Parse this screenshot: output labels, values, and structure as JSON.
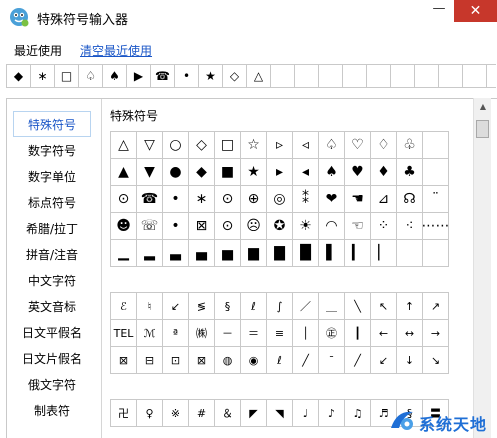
{
  "window": {
    "title": "特殊符号输入器",
    "minimize_label": "—",
    "close_label": "✕"
  },
  "recent": {
    "label": "最近使用",
    "clear_label": "清空最近使用",
    "symbols": [
      "◆",
      "∗",
      "□",
      "♤",
      "♠",
      "▶",
      "☎",
      "•",
      "★",
      "◇",
      "△",
      "",
      "",
      "",
      "",
      "",
      "",
      "",
      "",
      ""
    ]
  },
  "sidebar": {
    "items": [
      {
        "label": "特殊符号",
        "active": true
      },
      {
        "label": "数字符号",
        "active": false
      },
      {
        "label": "数字单位",
        "active": false
      },
      {
        "label": "标点符号",
        "active": false
      },
      {
        "label": "希腊/拉丁",
        "active": false
      },
      {
        "label": "拼音/注音",
        "active": false
      },
      {
        "label": "中文字符",
        "active": false
      },
      {
        "label": "英文音标",
        "active": false
      },
      {
        "label": "日文平假名",
        "active": false
      },
      {
        "label": "日文片假名",
        "active": false
      },
      {
        "label": "俄文字符",
        "active": false
      },
      {
        "label": "制表符",
        "active": false
      }
    ]
  },
  "main": {
    "section_title": "特殊符号",
    "grid1": [
      [
        "△",
        "▽",
        "○",
        "◇",
        "□",
        "☆",
        "▹",
        "◃",
        "♤",
        "♡",
        "♢",
        "♧"
      ],
      [
        "▲",
        "▼",
        "●",
        "◆",
        "■",
        "★",
        "▸",
        "◂",
        "♠",
        "♥",
        "♦",
        "♣"
      ],
      [
        "⊙",
        "☎",
        "•",
        "∗",
        "⊙",
        "⊕",
        "◎",
        "⁑",
        "❤",
        "☚",
        "⊿",
        "☊",
        "¨"
      ],
      [
        "☻",
        "☏",
        "•",
        "⊠",
        "⊙",
        "☹",
        "✪",
        "☀",
        "◠",
        "☜",
        "⁘",
        "⁖",
        "⋯⋯"
      ],
      [
        "▁",
        "▂",
        "▃",
        "▄",
        "▅",
        "▆",
        "▇",
        "█",
        "▌",
        "▎",
        "▏"
      ]
    ],
    "grid2": [
      [
        "ℰ",
        "♮",
        "↙",
        "≶",
        "§",
        "ℓ",
        "∫",
        "／",
        "＿",
        "╲",
        "↖",
        "↑",
        "↗"
      ],
      [
        "TEL",
        "ℳ",
        "ª",
        "㈱",
        "－",
        "＝",
        "≡",
        "│",
        "㊣",
        "┃",
        "←",
        "↔",
        "→"
      ],
      [
        "⊠",
        "⊟",
        "⊡",
        "⊠",
        "◍",
        "◉",
        "ℓ",
        "╱",
        "ˉ",
        "╱",
        "↙",
        "↓",
        "↘"
      ]
    ],
    "grid3": [
      [
        "卍",
        "♀",
        "※",
        "#",
        "＆",
        "◤",
        "◥",
        "♩",
        "♪",
        "♫",
        "♬",
        "§",
        "〓"
      ]
    ]
  },
  "watermark": {
    "text": "系统天地"
  },
  "colors": {
    "accent": "#1a56c7",
    "close": "#c7372b",
    "grid_line": "#c9c9c9"
  }
}
